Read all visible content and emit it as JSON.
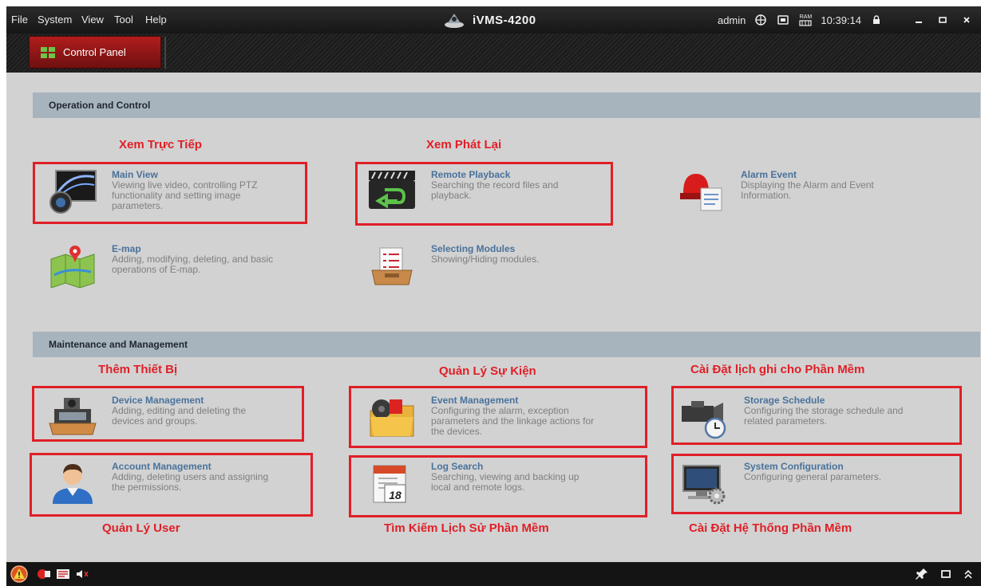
{
  "window": {
    "title": "iVMS-4200",
    "menus": [
      "File",
      "System",
      "View",
      "Tool",
      "Help"
    ],
    "user": "admin",
    "ram_label": "RAM",
    "time": "10:39:14"
  },
  "tabs": [
    {
      "label": "Control Panel"
    }
  ],
  "sections": [
    {
      "title": "Operation and Control"
    },
    {
      "title": "Maintenance and Management"
    }
  ],
  "modules": {
    "main_view": {
      "title": "Main View",
      "desc": [
        "Viewing live video, controlling PTZ",
        "functionality and setting image",
        "parameters."
      ]
    },
    "remote_playback": {
      "title": "Remote Playback",
      "desc": [
        "Searching the record files and",
        "playback."
      ]
    },
    "alarm_event": {
      "title": "Alarm Event",
      "desc": [
        "Displaying the Alarm and Event",
        "Information."
      ]
    },
    "emap": {
      "title": "E-map",
      "desc": [
        "Adding, modifying, deleting, and basic",
        "operations of E-map."
      ]
    },
    "selecting_modules": {
      "title": "Selecting Modules",
      "desc": [
        "Showing/Hiding modules."
      ]
    },
    "device_management": {
      "title": "Device Management",
      "desc": [
        "Adding, editing and deleting the",
        "devices and groups."
      ]
    },
    "event_management": {
      "title": "Event Management",
      "desc": [
        "Configuring the alarm, exception",
        "parameters and the linkage actions for",
        "the devices."
      ]
    },
    "storage_schedule": {
      "title": "Storage Schedule",
      "desc": [
        "Configuring the storage schedule and",
        "related parameters."
      ]
    },
    "account_management": {
      "title": "Account Management",
      "desc": [
        "Adding, deleting users and assigning",
        "the permissions."
      ]
    },
    "log_search": {
      "title": "Log Search",
      "desc": [
        "Searching, viewing and backing up",
        "local and remote logs."
      ]
    },
    "system_configuration": {
      "title": "System Configuration",
      "desc": [
        "Configuring general parameters."
      ]
    }
  },
  "annotations": {
    "xem_truc_tiep": "Xem Trực Tiếp",
    "xem_phat_lai": "Xem Phát Lại",
    "them_thiet_bi": "Thêm Thiết Bị",
    "quan_ly_su_kien": "Quản Lý Sự Kiện",
    "cai_dat_lich_ghi": "Cài Đặt lịch ghi cho Phần Mềm",
    "quan_ly_user": "Quản Lý User",
    "tim_kiem_lich_su": "Tìm Kiếm Lịch Sử Phần Mềm",
    "cai_dat_he_thong": "Cài Đặt Hệ Thống Phần Mềm"
  },
  "log_icon_day": "18",
  "icons": {
    "accent_red": "#e01f26",
    "title_blue": "#49729b",
    "section_bg": "#a7b3bd"
  }
}
